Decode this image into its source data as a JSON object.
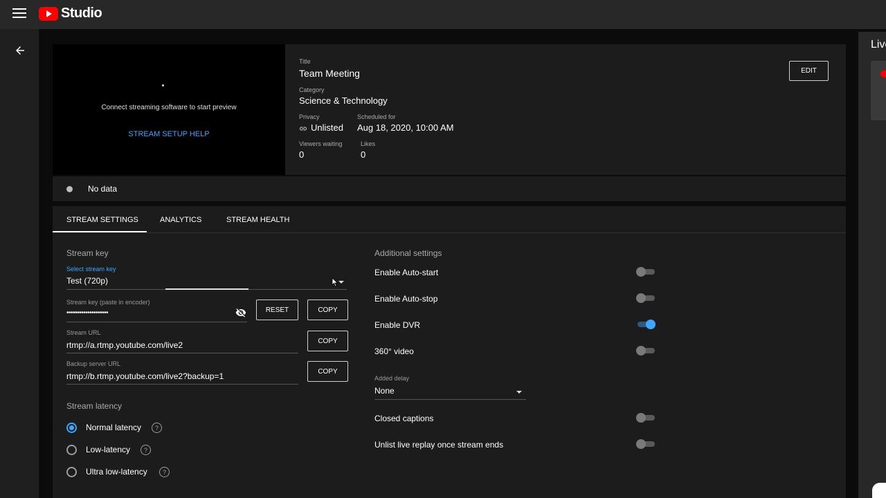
{
  "app": {
    "name": "Studio",
    "brand_color": "#ff0000",
    "accent_color": "#3ea6ff"
  },
  "preview": {
    "message": "Connect streaming software to start preview",
    "help_link": "STREAM SETUP HELP"
  },
  "details": {
    "title_label": "Title",
    "title": "Team Meeting",
    "category_label": "Category",
    "category": "Science & Technology",
    "privacy_label": "Privacy",
    "privacy": "Unlisted",
    "scheduled_label": "Scheduled for",
    "scheduled": "Aug 18, 2020, 10:00 AM",
    "viewers_label": "Viewers waiting",
    "viewers": "0",
    "likes_label": "Likes",
    "likes": "0",
    "edit_label": "EDIT"
  },
  "status": {
    "text": "No data"
  },
  "tabs": [
    {
      "label": "STREAM SETTINGS"
    },
    {
      "label": "ANALYTICS"
    },
    {
      "label": "STREAM HEALTH"
    }
  ],
  "stream_key": {
    "section_title": "Stream key",
    "select_label": "Select stream key",
    "select_value": "Test (720p)",
    "key_label": "Stream key (paste in encoder)",
    "key_value": "••••••••••••••••••••",
    "reset_label": "RESET",
    "copy_label": "COPY",
    "url_label": "Stream URL",
    "url_value": "rtmp://a.rtmp.youtube.com/live2",
    "backup_label": "Backup server URL",
    "backup_value": "rtmp://b.rtmp.youtube.com/live2?backup=1"
  },
  "latency": {
    "section_title": "Stream latency",
    "options": [
      {
        "label": "Normal latency",
        "selected": true
      },
      {
        "label": "Low-latency",
        "selected": false
      },
      {
        "label": "Ultra low-latency",
        "selected": false
      }
    ]
  },
  "additional": {
    "section_title": "Additional settings",
    "toggles": [
      {
        "label": "Enable Auto-start",
        "on": false
      },
      {
        "label": "Enable Auto-stop",
        "on": false
      },
      {
        "label": "Enable DVR",
        "on": true
      },
      {
        "label": "360° video",
        "on": false
      }
    ],
    "delay_label": "Added delay",
    "delay_value": "None",
    "toggles2": [
      {
        "label": "Closed captions",
        "on": false
      },
      {
        "label": "Unlist live replay once stream ends",
        "on": false
      }
    ]
  },
  "right_panel": {
    "title": "Live"
  }
}
